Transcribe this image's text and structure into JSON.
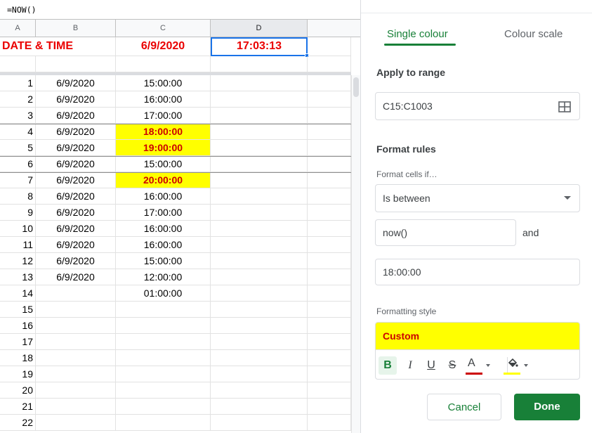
{
  "formula_bar": {
    "text": "=NOW()"
  },
  "columns": [
    "A",
    "B",
    "C",
    "D"
  ],
  "title_row": {
    "a": "DATE & TIME",
    "c": "6/9/2020",
    "d": "17:03:13"
  },
  "rows": [
    {
      "n": "1",
      "b": "6/9/2020",
      "c": "15:00:00"
    },
    {
      "n": "2",
      "b": "6/9/2020",
      "c": "16:00:00"
    },
    {
      "n": "3",
      "b": "6/9/2020",
      "c": "17:00:00"
    },
    {
      "n": "4",
      "b": "6/9/2020",
      "c": "18:00:00"
    },
    {
      "n": "5",
      "b": "6/9/2020",
      "c": "19:00:00"
    },
    {
      "n": "6",
      "b": "6/9/2020",
      "c": "15:00:00"
    },
    {
      "n": "7",
      "b": "6/9/2020",
      "c": "20:00:00"
    },
    {
      "n": "8",
      "b": "6/9/2020",
      "c": "16:00:00"
    },
    {
      "n": "9",
      "b": "6/9/2020",
      "c": "17:00:00"
    },
    {
      "n": "10",
      "b": "6/9/2020",
      "c": "16:00:00"
    },
    {
      "n": "11",
      "b": "6/9/2020",
      "c": "16:00:00"
    },
    {
      "n": "12",
      "b": "6/9/2020",
      "c": "15:00:00"
    },
    {
      "n": "13",
      "b": "6/9/2020",
      "c": "12:00:00"
    },
    {
      "n": "14",
      "b": "",
      "c": "01:00:00"
    },
    {
      "n": "15",
      "b": "",
      "c": ""
    },
    {
      "n": "16",
      "b": "",
      "c": ""
    },
    {
      "n": "17",
      "b": "",
      "c": ""
    },
    {
      "n": "18",
      "b": "",
      "c": ""
    },
    {
      "n": "19",
      "b": "",
      "c": ""
    },
    {
      "n": "20",
      "b": "",
      "c": ""
    },
    {
      "n": "21",
      "b": "",
      "c": ""
    },
    {
      "n": "22",
      "b": "",
      "c": ""
    }
  ],
  "highlighted_rows": [
    "4",
    "5",
    "7"
  ],
  "highlight_colors": {
    "fill": "#ffff00",
    "text": "#cc0000"
  },
  "panel": {
    "tabs": {
      "single": "Single colour",
      "scale": "Colour scale"
    },
    "apply_to_range": {
      "label": "Apply to range",
      "value": "C15:C1003",
      "icon": "grid-select-icon"
    },
    "format_rules": {
      "title": "Format rules",
      "condition_label": "Format cells if…",
      "condition": "Is between",
      "value1": "now()",
      "and_label": "and",
      "value2": "18:00:00"
    },
    "formatting_style": {
      "label": "Formatting style",
      "preview": "Custom",
      "bold": "B",
      "italic": "I",
      "underline": "U",
      "strikethrough": "S",
      "text_color_letter": "A",
      "text_color": "#cc0000",
      "fill_color": "#ffff00"
    },
    "buttons": {
      "cancel": "Cancel",
      "done": "Done"
    },
    "accent": "#188038"
  }
}
